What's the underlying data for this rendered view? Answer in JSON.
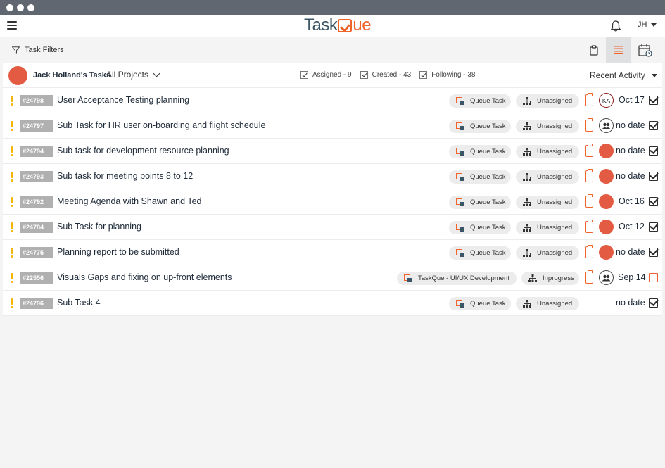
{
  "app": {
    "logo_part1": "Task",
    "logo_part2": "ue",
    "user_initials": "JH"
  },
  "toolbar": {
    "filters_label": "Task Filters"
  },
  "list_header": {
    "owner_title": "Jack Holland's Tasks",
    "project_select": "All Projects",
    "filters": [
      {
        "label": "Assigned - 9",
        "checked": true
      },
      {
        "label": "Created - 43",
        "checked": true
      },
      {
        "label": "Following - 38",
        "checked": true
      }
    ],
    "sort_select": "Recent Activity"
  },
  "tasks": [
    {
      "id": "#24798",
      "title": "User Acceptance Testing planning",
      "queue": "Queue Task",
      "status": "Unassigned",
      "assignee": "initials",
      "assignee_initials": "KA",
      "due": "Oct 17",
      "done": true
    },
    {
      "id": "#24797",
      "title": "Sub Task for HR user on-boarding and flight schedule",
      "queue": "Queue Task",
      "status": "Unassigned",
      "assignee": "group",
      "due": "no date",
      "done": true
    },
    {
      "id": "#24794",
      "title": "Sub task for development resource planning",
      "queue": "Queue Task",
      "status": "Unassigned",
      "assignee": "red",
      "due": "no date",
      "done": true
    },
    {
      "id": "#24793",
      "title": "Sub task  for meeting points 8 to 12",
      "queue": "Queue Task",
      "status": "Unassigned",
      "assignee": "red",
      "due": "no date",
      "done": true
    },
    {
      "id": "#24792",
      "title": "Meeting Agenda with Shawn and Ted",
      "queue": "Queue Task",
      "status": "Unassigned",
      "assignee": "red",
      "due": "Oct 16",
      "done": true
    },
    {
      "id": "#24784",
      "title": "Sub Task  for planning",
      "queue": "Queue Task",
      "status": "Unassigned",
      "assignee": "red",
      "due": "Oct 12",
      "done": true
    },
    {
      "id": "#24775",
      "title": "Planning report to be submitted",
      "queue": "Queue Task",
      "status": "Unassigned",
      "assignee": "red",
      "due": "no date",
      "done": true
    },
    {
      "id": "#22556",
      "title": "Visuals Gaps and fixing on up-front elements",
      "queue": "TaskQue - UI/UX Development",
      "status": "Inprogress",
      "assignee": "group",
      "due": "Sep 14",
      "done": false
    },
    {
      "id": "#24796",
      "title": "Sub Task 4",
      "queue": "Queue Task",
      "status": "Unassigned",
      "assignee": "none",
      "due": "no date",
      "done": true
    }
  ],
  "colors": {
    "accent": "#f0642c",
    "brand_dark": "#3a5566",
    "priority": "#f4b400",
    "avatar_red": "#e35b42"
  }
}
